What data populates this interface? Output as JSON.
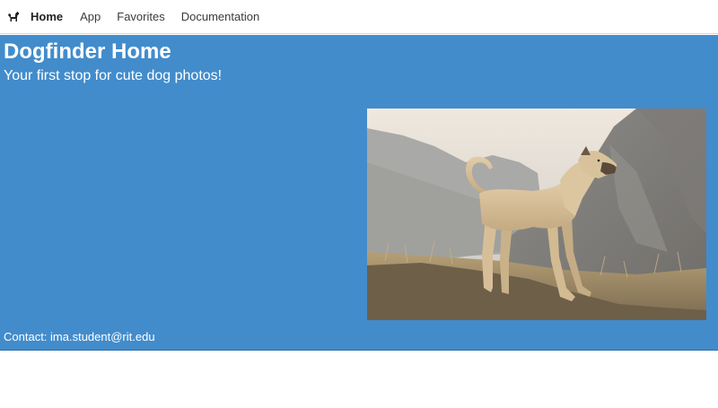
{
  "nav": {
    "brand_icon": "dog-icon",
    "items": [
      {
        "label": "Home",
        "active": true
      },
      {
        "label": "App",
        "active": false
      },
      {
        "label": "Favorites",
        "active": false
      },
      {
        "label": "Documentation",
        "active": false
      }
    ]
  },
  "hero": {
    "title": "Dogfinder Home",
    "subtitle": "Your first stop for cute dog photos!",
    "background_color": "#428ccc",
    "image_subject": "tan dog standing on a hillside"
  },
  "footer": {
    "contact": "Contact: ima.student@rit.edu"
  }
}
